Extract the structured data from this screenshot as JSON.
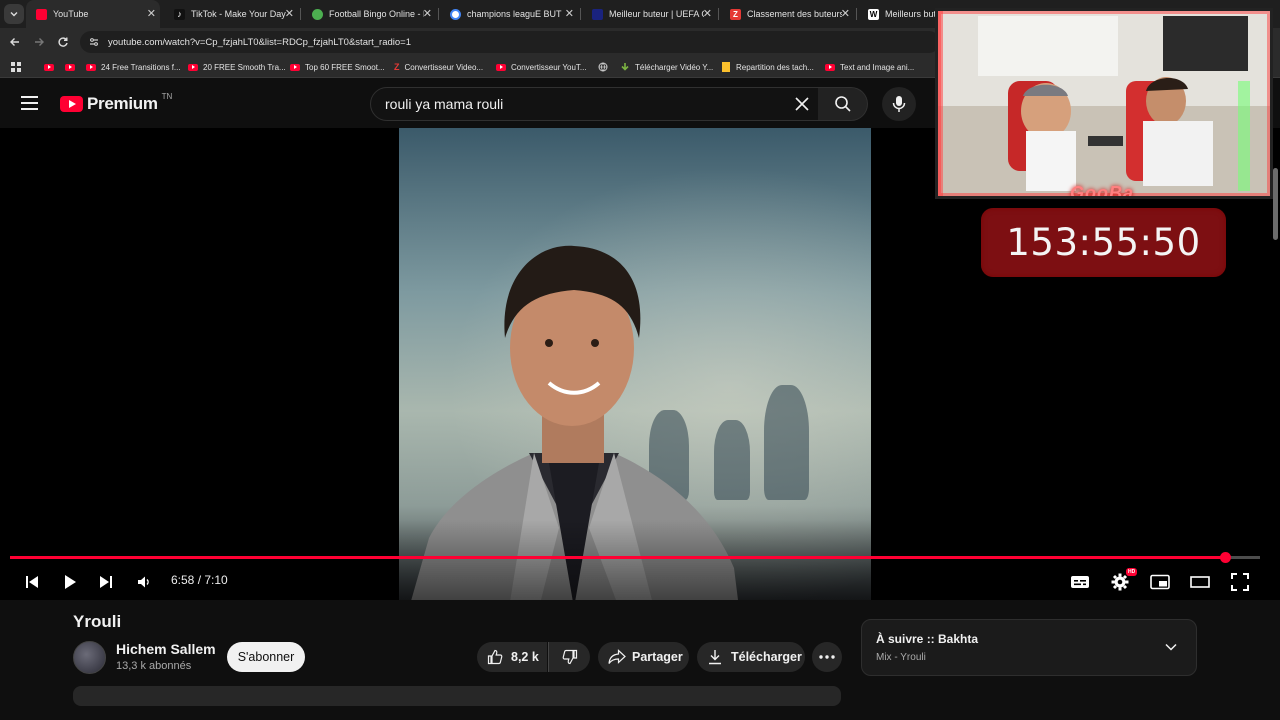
{
  "browser": {
    "tabs": [
      {
        "title": "YouTube",
        "favicon_color": "#ff0033"
      },
      {
        "title": "TikTok - Make Your Day",
        "favicon_color": "#111111"
      },
      {
        "title": "Football Bingo Online - P",
        "favicon_color": "#4caf50"
      },
      {
        "title": "champions leaguE BUTEU",
        "favicon_color": "#4285f4"
      },
      {
        "title": "Meilleur buteur | UEFA Ch",
        "favicon_color": "#1a237e"
      },
      {
        "title": "Classement des buteurs L",
        "favicon_color": "#e53935"
      },
      {
        "title": "Meilleurs buteu",
        "favicon_color": "#ffffff"
      }
    ],
    "url": "youtube.com/watch?v=Cp_fzjahLT0&list=RDCp_fzjahLT0&start_radio=1",
    "bookmarks": [
      {
        "label": "",
        "icon": "youtube-icon"
      },
      {
        "label": "",
        "icon": "youtube-icon"
      },
      {
        "label": "24 Free Transitions f...",
        "icon": "youtube-icon"
      },
      {
        "label": "20 FREE Smooth Tra...",
        "icon": "youtube-icon"
      },
      {
        "label": "Top 60 FREE Smoot...",
        "icon": "youtube-icon"
      },
      {
        "label": "Convertisseur Video...",
        "icon": "z-icon"
      },
      {
        "label": "Convertisseur YouT...",
        "icon": "youtube-icon"
      },
      {
        "label": "",
        "icon": "globe-icon"
      },
      {
        "label": "Télécharger Vidéo Y...",
        "icon": "download-icon"
      },
      {
        "label": "Repartition des tach...",
        "icon": "doc-icon"
      },
      {
        "label": "Text and Image ani...",
        "icon": "youtube-icon"
      }
    ]
  },
  "header": {
    "logo_text": "Premium",
    "country_code": "TN",
    "search_value": "rouli ya mama rouli"
  },
  "player": {
    "current_time": "6:58",
    "duration": "7:10",
    "time_display": "6:58 / 7:10",
    "progress_fraction": 0.9721,
    "hd_badge": "HD"
  },
  "video": {
    "title": "Yrouli",
    "channel": "Hichem Sallem",
    "subscribers": "13,3 k abonnés",
    "subscribe_label": "S'abonner",
    "likes": "8,2 k",
    "share_label": "Partager",
    "download_label": "Télécharger"
  },
  "up_next": {
    "title": "À suivre :: Bakhta",
    "subtitle": "Mix - Yrouli"
  },
  "stream_overlay": {
    "watermark": "GooBa",
    "timer": "153:55:50"
  },
  "colors": {
    "accent": "#ff0033",
    "timer_bg": "#7d0f12"
  }
}
